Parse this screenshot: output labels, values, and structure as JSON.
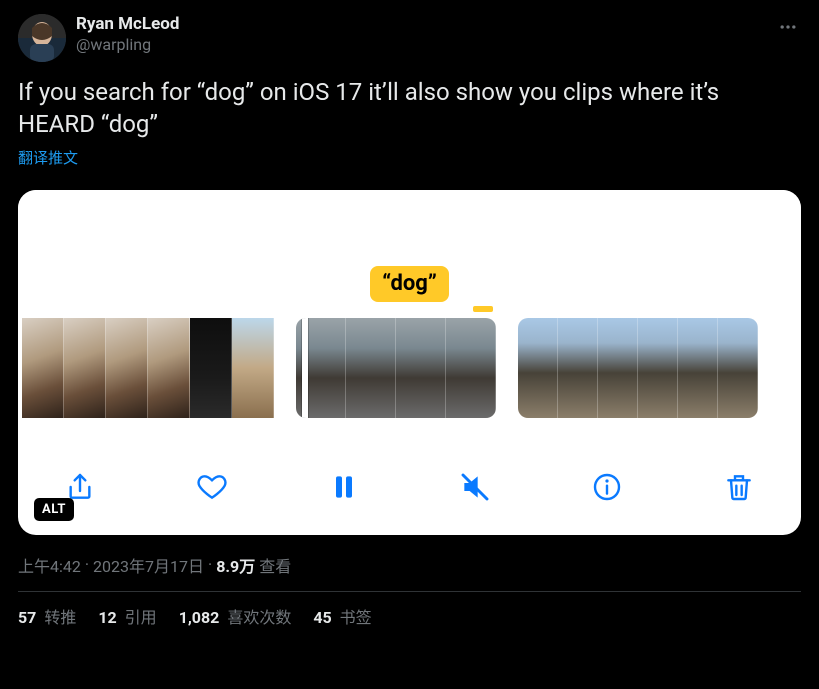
{
  "user": {
    "display_name": "Ryan McLeod",
    "handle": "@warpling"
  },
  "tweet_text": "If you search for “dog” on iOS 17 it’ll also show you clips where it’s HEARD “dog”",
  "translate_label": "翻译推文",
  "media": {
    "dog_label": "“dog”",
    "alt_badge": "ALT"
  },
  "meta": {
    "time": "上午4:42",
    "sep": " · ",
    "date": "2023年7月17日",
    "views_count": "8.9万",
    "views_label": " 查看"
  },
  "stats": {
    "retweets_count": "57",
    "retweets_label": " 转推",
    "quotes_count": "12",
    "quotes_label": " 引用",
    "likes_count": "1,082",
    "likes_label": " 喜欢次数",
    "bookmarks_count": "45",
    "bookmarks_label": " 书签"
  }
}
